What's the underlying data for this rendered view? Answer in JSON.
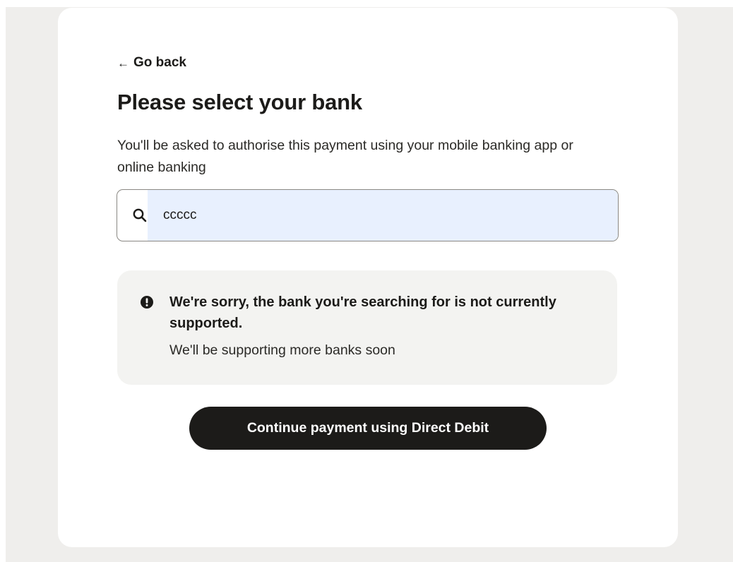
{
  "navigation": {
    "back_arrow": "←",
    "back_label": "Go back"
  },
  "header": {
    "title": "Please select your bank",
    "subtitle": "You'll be asked to authorise this payment using your mobile banking app or online banking"
  },
  "search": {
    "icon": "search-icon",
    "value": "ccccc",
    "autofill_highlight_color": "#e8f0fe"
  },
  "notice": {
    "icon": "alert-circle-icon",
    "title": "We're sorry, the bank you're searching for is not currently supported.",
    "body": "We'll be supporting more banks soon"
  },
  "actions": {
    "continue_label": "Continue payment using Direct Debit"
  },
  "colors": {
    "page_background": "#efeeec",
    "card_background": "#ffffff",
    "notice_background": "#f3f3f1",
    "primary_button": "#1c1b19",
    "text": "#1c1b19"
  }
}
